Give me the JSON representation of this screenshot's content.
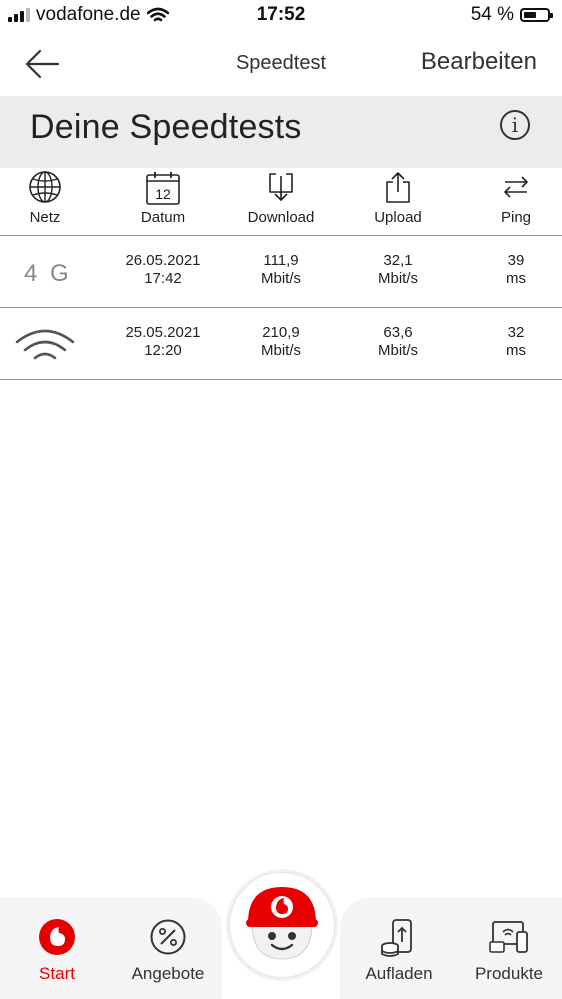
{
  "status_bar": {
    "carrier": "vodafone.de",
    "time": "17:52",
    "battery_percent": "54 %",
    "battery_level": 0.54
  },
  "nav": {
    "title": "Speedtest",
    "edit_label": "Bearbeiten"
  },
  "section": {
    "heading": "Deine Speedtests",
    "info_glyph": "i"
  },
  "columns": [
    {
      "label": "Netz",
      "icon": "globe-icon"
    },
    {
      "label": "Datum",
      "icon": "calendar-icon",
      "icon_text": "12"
    },
    {
      "label": "Download",
      "icon": "download-icon"
    },
    {
      "label": "Upload",
      "icon": "upload-icon"
    },
    {
      "label": "Ping",
      "icon": "ping-arrows-icon"
    }
  ],
  "tests": [
    {
      "network_type": "4G",
      "network_label": "4 G",
      "date": "26.05.2021",
      "time": "17:42",
      "download_value": "111,9",
      "download_unit": "Mbit/s",
      "upload_value": "32,1",
      "upload_unit": "Mbit/s",
      "ping_value": "39",
      "ping_unit": "ms"
    },
    {
      "network_type": "WLAN",
      "network_icon": "wifi-icon",
      "date": "25.05.2021",
      "time": "12:20",
      "download_value": "210,9",
      "download_unit": "Mbit/s",
      "upload_value": "63,6",
      "upload_unit": "Mbit/s",
      "ping_value": "32",
      "ping_unit": "ms"
    }
  ],
  "tabbar": {
    "tabs": [
      {
        "label": "Start",
        "icon": "vodafone-logo-icon",
        "active": true
      },
      {
        "label": "Angebote",
        "icon": "percent-icon",
        "active": false
      },
      {
        "label": "Aufladen",
        "icon": "phone-coins-icon",
        "active": false
      },
      {
        "label": "Produkte",
        "icon": "devices-icon",
        "active": false
      }
    ],
    "center_button_icon": "tobi-assistant-icon"
  },
  "colors": {
    "accent": "#e60000",
    "header_bg": "#ececec",
    "tab_bg": "#f5f5f5",
    "divider": "#999999"
  }
}
